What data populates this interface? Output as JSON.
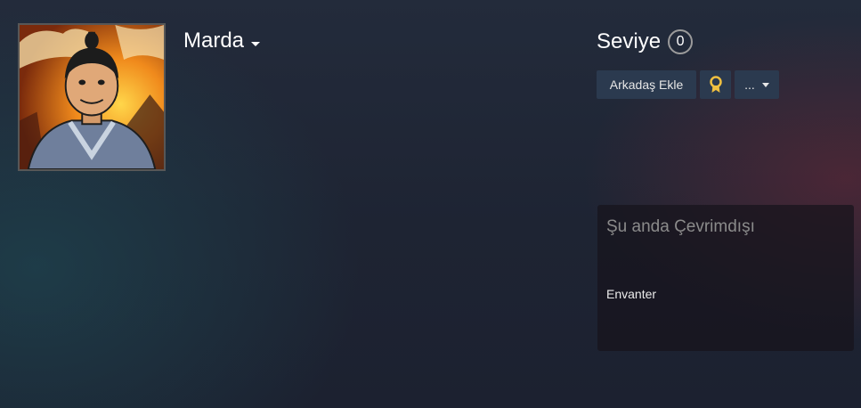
{
  "profile": {
    "name": "Marda",
    "level_label": "Seviye",
    "level_value": "0"
  },
  "actions": {
    "add_friend_label": "Arkadaş Ekle",
    "award_icon": "award-ribbon-icon",
    "more_label": "..."
  },
  "status": {
    "text": "Şu anda Çevrimdışı",
    "inventory_label": "Envanter"
  },
  "colors": {
    "button_bg": "#2b3a4f",
    "award_gold": "#f0c040",
    "panel_bg": "#16141c"
  }
}
